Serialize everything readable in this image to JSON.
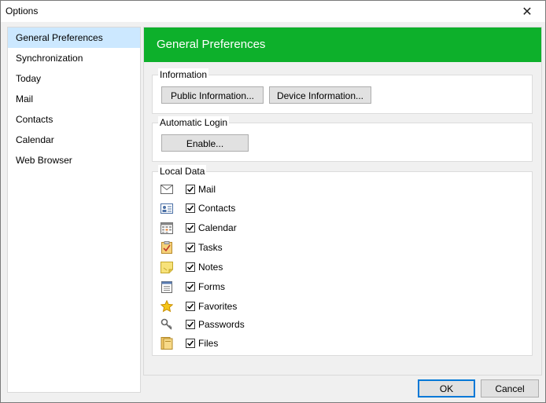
{
  "window": {
    "title": "Options"
  },
  "sidebar": {
    "items": [
      {
        "label": "General Preferences"
      },
      {
        "label": "Synchronization"
      },
      {
        "label": "Today"
      },
      {
        "label": "Mail"
      },
      {
        "label": "Contacts"
      },
      {
        "label": "Calendar"
      },
      {
        "label": "Web Browser"
      }
    ],
    "selected": "General Preferences"
  },
  "header": {
    "title": "General Preferences",
    "color": "#0db02b"
  },
  "information": {
    "legend": "Information",
    "public_label": "Public Information...",
    "device_label": "Device Information..."
  },
  "auto_login": {
    "legend": "Automatic Login",
    "enable_label": "Enable..."
  },
  "local_data": {
    "legend": "Local Data",
    "items": [
      {
        "label": "Mail",
        "icon": "envelope-icon",
        "checked": true
      },
      {
        "label": "Contacts",
        "icon": "contact-card-icon",
        "checked": true
      },
      {
        "label": "Calendar",
        "icon": "calendar-icon",
        "checked": true
      },
      {
        "label": "Tasks",
        "icon": "tasks-clipboard-icon",
        "checked": true
      },
      {
        "label": "Notes",
        "icon": "sticky-note-icon",
        "checked": true
      },
      {
        "label": "Forms",
        "icon": "form-icon",
        "checked": true
      },
      {
        "label": "Favorites",
        "icon": "star-icon",
        "checked": true
      },
      {
        "label": "Passwords",
        "icon": "keys-icon",
        "checked": true
      },
      {
        "label": "Files",
        "icon": "folder-icon",
        "checked": true
      }
    ]
  },
  "footer": {
    "ok_label": "OK",
    "cancel_label": "Cancel"
  }
}
